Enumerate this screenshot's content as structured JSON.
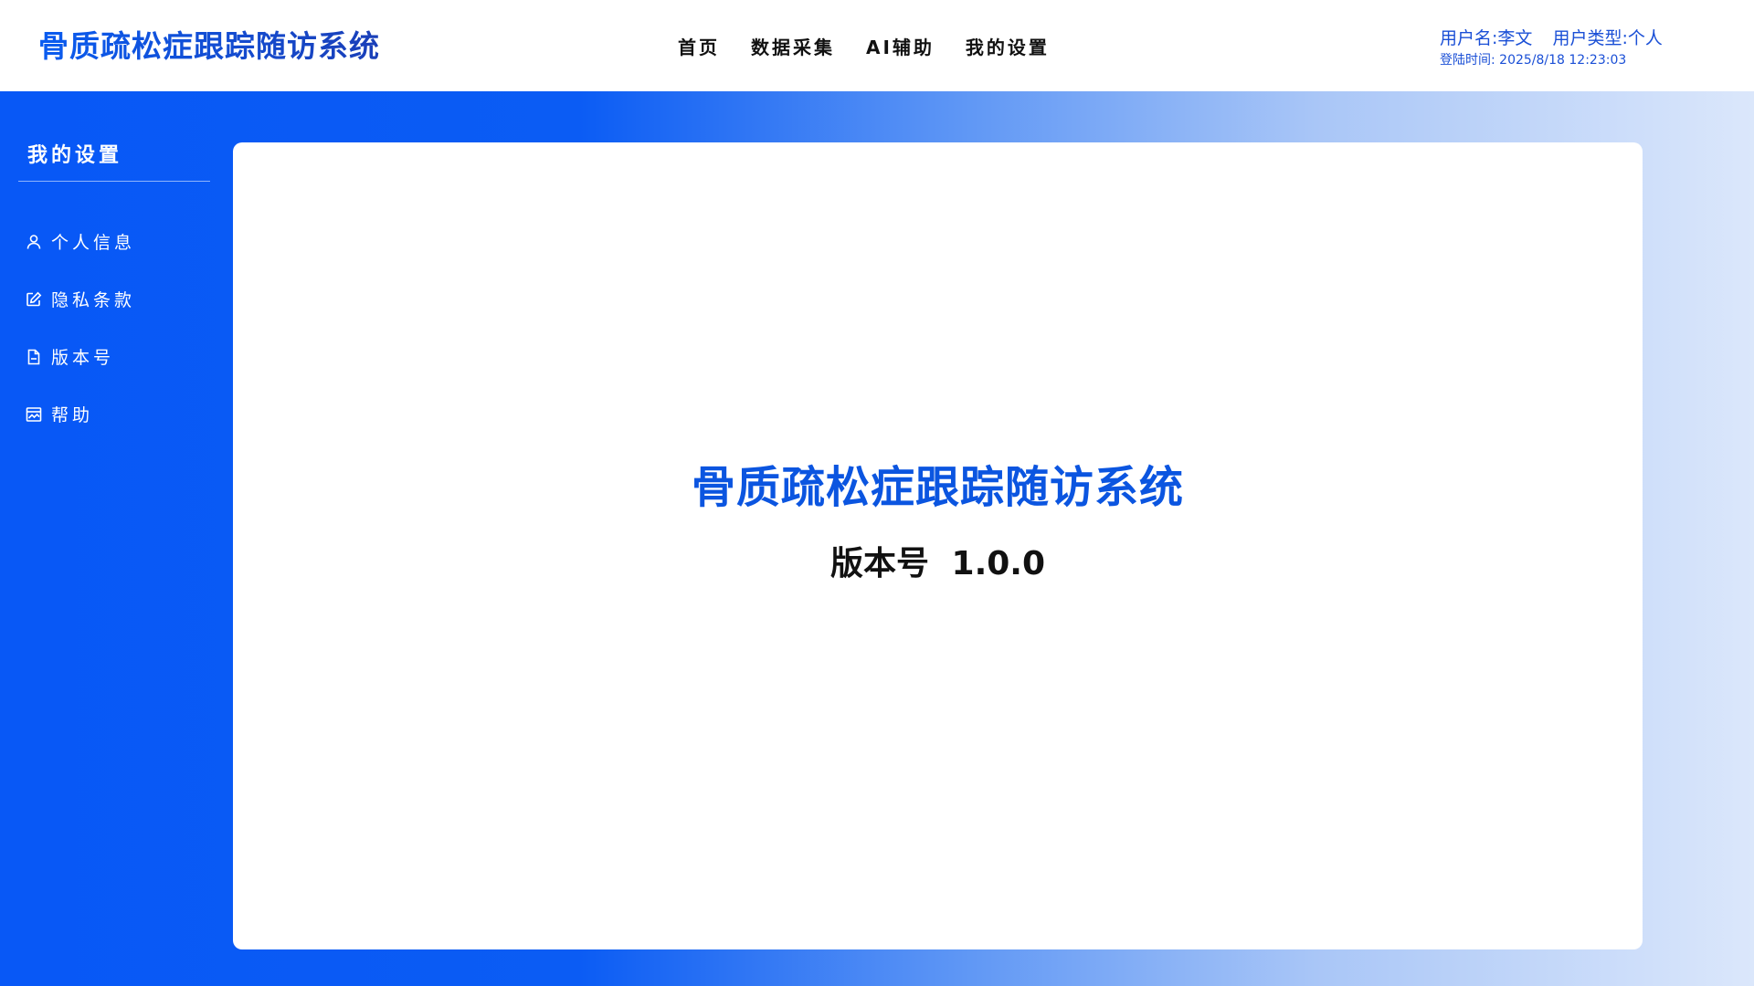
{
  "header": {
    "app_title": "骨质疏松症跟踪随访系统",
    "nav": [
      {
        "label": "首页"
      },
      {
        "label": "数据采集"
      },
      {
        "label": "AI辅助"
      },
      {
        "label": "我的设置"
      }
    ],
    "user": {
      "username": "用户名:李文",
      "usertype": "用户类型:个人",
      "login_time": "登陆时间:  2025/8/18 12:23:03"
    }
  },
  "sidebar": {
    "title": "我的设置",
    "items": [
      {
        "label": "个人信息",
        "icon": "user-icon"
      },
      {
        "label": "隐私条款",
        "icon": "edit-icon"
      },
      {
        "label": "版本号",
        "icon": "document-icon"
      },
      {
        "label": "帮助",
        "icon": "image-icon"
      }
    ]
  },
  "content": {
    "title": "骨质疏松症跟踪随访系统",
    "version_label": "版本号",
    "version_value": "1.0.0"
  },
  "colors": {
    "accent": "#0b55e0",
    "sidebar_bg": "#0858f6"
  }
}
